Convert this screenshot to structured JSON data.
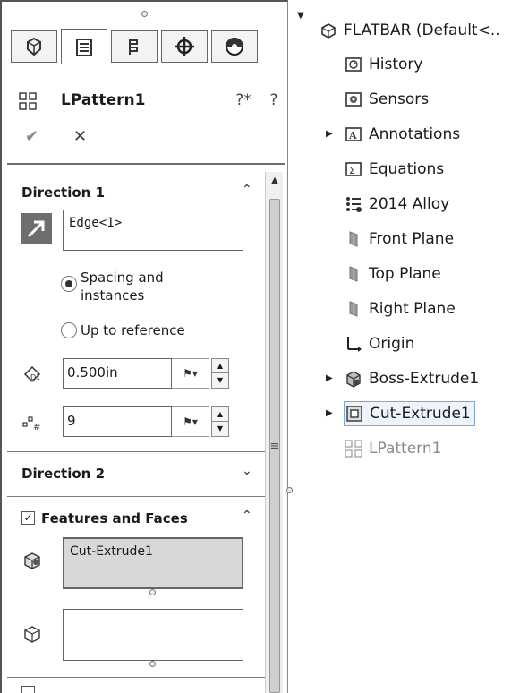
{
  "property_manager": {
    "tabs": [
      {
        "name": "featuremanager",
        "icon": "featuremanager-icon"
      },
      {
        "name": "propertymanager",
        "icon": "propertymanager-icon"
      },
      {
        "name": "configurationmanager",
        "icon": "configurationmanager-icon"
      },
      {
        "name": "dimxpertmanager",
        "icon": "dimxpert-icon"
      },
      {
        "name": "displaymanager",
        "icon": "displaymanager-icon"
      }
    ],
    "title": "LPattern1",
    "whats_wrong_glyph": "?*",
    "help_glyph": "?",
    "ok_glyph": "✔",
    "cancel_glyph": "✕",
    "direction1": {
      "title": "Direction 1",
      "edge_value": "Edge<1>",
      "spacing_label_line1": "Spacing and",
      "spacing_label_line2": "instances",
      "up_to_reference_label": "Up to reference",
      "selected_option": "Spacing and instances",
      "spacing_value": "0.500in",
      "instances_value": "9"
    },
    "direction2": {
      "title": "Direction 2"
    },
    "features_and_faces": {
      "title": "Features and Faces",
      "checked": true,
      "features_value": "Cut-Extrude1",
      "faces_value": ""
    }
  },
  "feature_tree": {
    "root_label": "FLATBAR  (Default<..",
    "items": [
      {
        "label": "History",
        "icon": "history-folder-icon",
        "expandable": false
      },
      {
        "label": "Sensors",
        "icon": "sensors-folder-icon",
        "expandable": false
      },
      {
        "label": "Annotations",
        "icon": "annotations-folder-icon",
        "expandable": true
      },
      {
        "label": "Equations",
        "icon": "equations-folder-icon",
        "expandable": false
      },
      {
        "label": "2014 Alloy",
        "icon": "material-icon",
        "expandable": false
      },
      {
        "label": "Front Plane",
        "icon": "plane-icon",
        "expandable": false
      },
      {
        "label": "Top Plane",
        "icon": "plane-icon",
        "expandable": false
      },
      {
        "label": "Right Plane",
        "icon": "plane-icon",
        "expandable": false
      },
      {
        "label": "Origin",
        "icon": "origin-icon",
        "expandable": false
      },
      {
        "label": "Boss-Extrude1",
        "icon": "boss-extrude-icon",
        "expandable": true
      },
      {
        "label": "Cut-Extrude1",
        "icon": "cut-extrude-icon",
        "expandable": true,
        "selected": true
      },
      {
        "label": "LPattern1",
        "icon": "linear-pattern-icon",
        "expandable": false,
        "dimmed": true
      }
    ]
  },
  "colors": {
    "selection_border": "#7aa7d6",
    "panel_border": "#555555",
    "filled_box": "#d8d8d8"
  }
}
